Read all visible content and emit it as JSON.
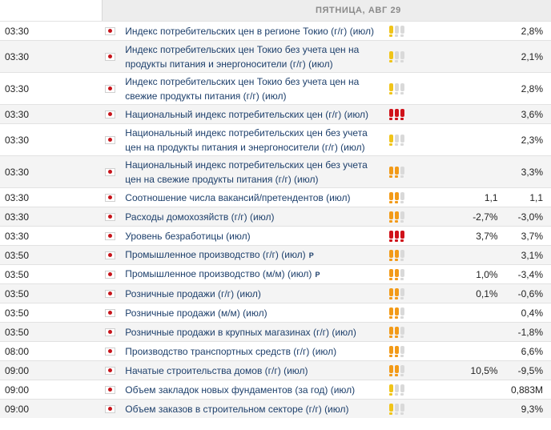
{
  "day_header": "ПЯТНИЦА, АВГ 29",
  "importance_colors": {
    "low": "#f0c419",
    "medium": "#f29a18",
    "high": "#d0121a",
    "inactive": "#d9d9d9"
  },
  "events": [
    {
      "time": "03:30",
      "country": "Japan",
      "event": "Индекс потребительских цен в регионе Токио (г/г) (июл)",
      "importance": "low",
      "actual": "",
      "forecast": "",
      "previous": "2,8%",
      "revised": ""
    },
    {
      "time": "03:30",
      "country": "Japan",
      "event": "Индекс потребительских цен Токио без учета цен на продукты питания и энергоносители (г/г) (июл)",
      "importance": "low",
      "actual": "",
      "forecast": "",
      "previous": "2,1%",
      "revised": ""
    },
    {
      "time": "03:30",
      "country": "Japan",
      "event": "Индекс потребительских цен Токио без учета цен на свежие продукты питания (г/г) (июл)",
      "importance": "low",
      "actual": "",
      "forecast": "",
      "previous": "2,8%",
      "revised": ""
    },
    {
      "time": "03:30",
      "country": "Japan",
      "event": "Национальный индекс потребительских цен (г/г) (июл)",
      "importance": "high",
      "actual": "",
      "forecast": "",
      "previous": "3,6%",
      "revised": ""
    },
    {
      "time": "03:30",
      "country": "Japan",
      "event": "Национальный индекс потребительских цен без учета цен на продукты питания и энергоносители (г/г) (июл)",
      "importance": "low",
      "actual": "",
      "forecast": "",
      "previous": "2,3%",
      "revised": ""
    },
    {
      "time": "03:30",
      "country": "Japan",
      "event": "Национальный индекс потребительских цен без учета цен на свежие продукты питания (г/г) (июл)",
      "importance": "medium",
      "actual": "",
      "forecast": "",
      "previous": "3,3%",
      "revised": ""
    },
    {
      "time": "03:30",
      "country": "Japan",
      "event": "Соотношение числа вакансий/претендентов (июл)",
      "importance": "medium",
      "actual": "",
      "forecast": "1,1",
      "previous": "1,1",
      "revised": ""
    },
    {
      "time": "03:30",
      "country": "Japan",
      "event": "Расходы домохозяйств (г/г) (июл)",
      "importance": "medium",
      "actual": "",
      "forecast": "-2,7%",
      "previous": "-3,0%",
      "revised": ""
    },
    {
      "time": "03:30",
      "country": "Japan",
      "event": "Уровень безработицы (июл)",
      "importance": "high",
      "actual": "",
      "forecast": "3,7%",
      "previous": "3,7%",
      "revised": ""
    },
    {
      "time": "03:50",
      "country": "Japan",
      "event": "Промышленное производство (г/г) (июл)",
      "importance": "medium",
      "actual": "",
      "forecast": "",
      "previous": "3,1%",
      "revised": "P"
    },
    {
      "time": "03:50",
      "country": "Japan",
      "event": "Промышленное производство (м/м) (июл)",
      "importance": "medium",
      "actual": "",
      "forecast": "1,0%",
      "previous": "-3,4%",
      "revised": "P"
    },
    {
      "time": "03:50",
      "country": "Japan",
      "event": "Розничные продажи (г/г) (июл)",
      "importance": "medium",
      "actual": "",
      "forecast": "0,1%",
      "previous": "-0,6%",
      "revised": ""
    },
    {
      "time": "03:50",
      "country": "Japan",
      "event": "Розничные продажи (м/м) (июл)",
      "importance": "medium",
      "actual": "",
      "forecast": "",
      "previous": "0,4%",
      "revised": ""
    },
    {
      "time": "03:50",
      "country": "Japan",
      "event": "Розничные продажи в крупных магазинах (г/г) (июл)",
      "importance": "medium",
      "actual": "",
      "forecast": "",
      "previous": "-1,8%",
      "revised": ""
    },
    {
      "time": "08:00",
      "country": "Japan",
      "event": "Производство транспортных средств (г/г) (июл)",
      "importance": "medium",
      "actual": "",
      "forecast": "",
      "previous": "6,6%",
      "revised": ""
    },
    {
      "time": "09:00",
      "country": "Japan",
      "event": "Начатые строительства домов (г/г) (июл)",
      "importance": "medium",
      "actual": "",
      "forecast": "10,5%",
      "previous": "-9,5%",
      "revised": ""
    },
    {
      "time": "09:00",
      "country": "Japan",
      "event": "Объем закладок новых фундаментов (за год) (июл)",
      "importance": "low",
      "actual": "",
      "forecast": "",
      "previous": "0,883M",
      "revised": ""
    },
    {
      "time": "09:00",
      "country": "Japan",
      "event": "Объем заказов в строительном секторе (г/г) (июл)",
      "importance": "low",
      "actual": "",
      "forecast": "",
      "previous": "9,3%",
      "revised": ""
    }
  ]
}
